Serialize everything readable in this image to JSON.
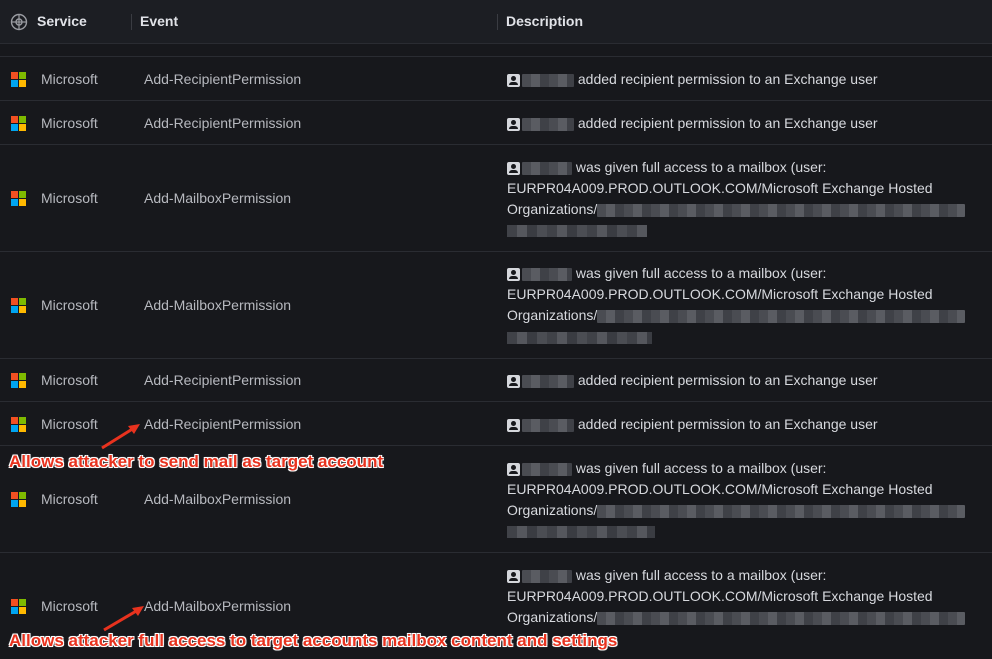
{
  "columns": {
    "service": "Service",
    "event": "Event",
    "description": "Description"
  },
  "colors": {
    "ms_red": "#f25022",
    "ms_green": "#7fba00",
    "ms_blue": "#00a4ef",
    "ms_yellow": "#ffb900",
    "annotation": "#e8321e"
  },
  "rows": [
    {
      "service": "Microsoft",
      "event": "Add-RecipientPermission",
      "desc1": "added recipient permission to an Exchange user"
    },
    {
      "service": "Microsoft",
      "event": "Add-RecipientPermission",
      "desc1": "added recipient permission to an Exchange user"
    },
    {
      "service": "Microsoft",
      "event": "Add-MailboxPermission",
      "desc1": "was given full access to a mailbox (user:",
      "desc2": "EURPR04A009.PROD.OUTLOOK.COM/Microsoft Exchange Hosted",
      "desc3": "Organizations/"
    },
    {
      "service": "Microsoft",
      "event": "Add-MailboxPermission",
      "desc1": "was given full access to a mailbox (user:",
      "desc2": "EURPR04A009.PROD.OUTLOOK.COM/Microsoft Exchange Hosted",
      "desc3": "Organizations/"
    },
    {
      "service": "Microsoft",
      "event": "Add-RecipientPermission",
      "desc1": "added recipient permission to an Exchange user"
    },
    {
      "service": "Microsoft",
      "event": "Add-RecipientPermission",
      "desc1": "added recipient permission to an Exchange user"
    },
    {
      "service": "Microsoft",
      "event": "Add-MailboxPermission",
      "desc1": "was given full access to a mailbox (user:",
      "desc2": "EURPR04A009.PROD.OUTLOOK.COM/Microsoft Exchange Hosted",
      "desc3": "Organizations/"
    },
    {
      "service": "Microsoft",
      "event": "Add-MailboxPermission",
      "desc1": "was given full access to a mailbox (user:",
      "desc2": "EURPR04A009.PROD.OUTLOOK.COM/Microsoft Exchange Hosted",
      "desc3": "Organizations/"
    }
  ],
  "annotations": {
    "send_as": "Allows attacker to send mail as target account",
    "full_access": "Allows attacker full access to target accounts mailbox content and settings"
  }
}
